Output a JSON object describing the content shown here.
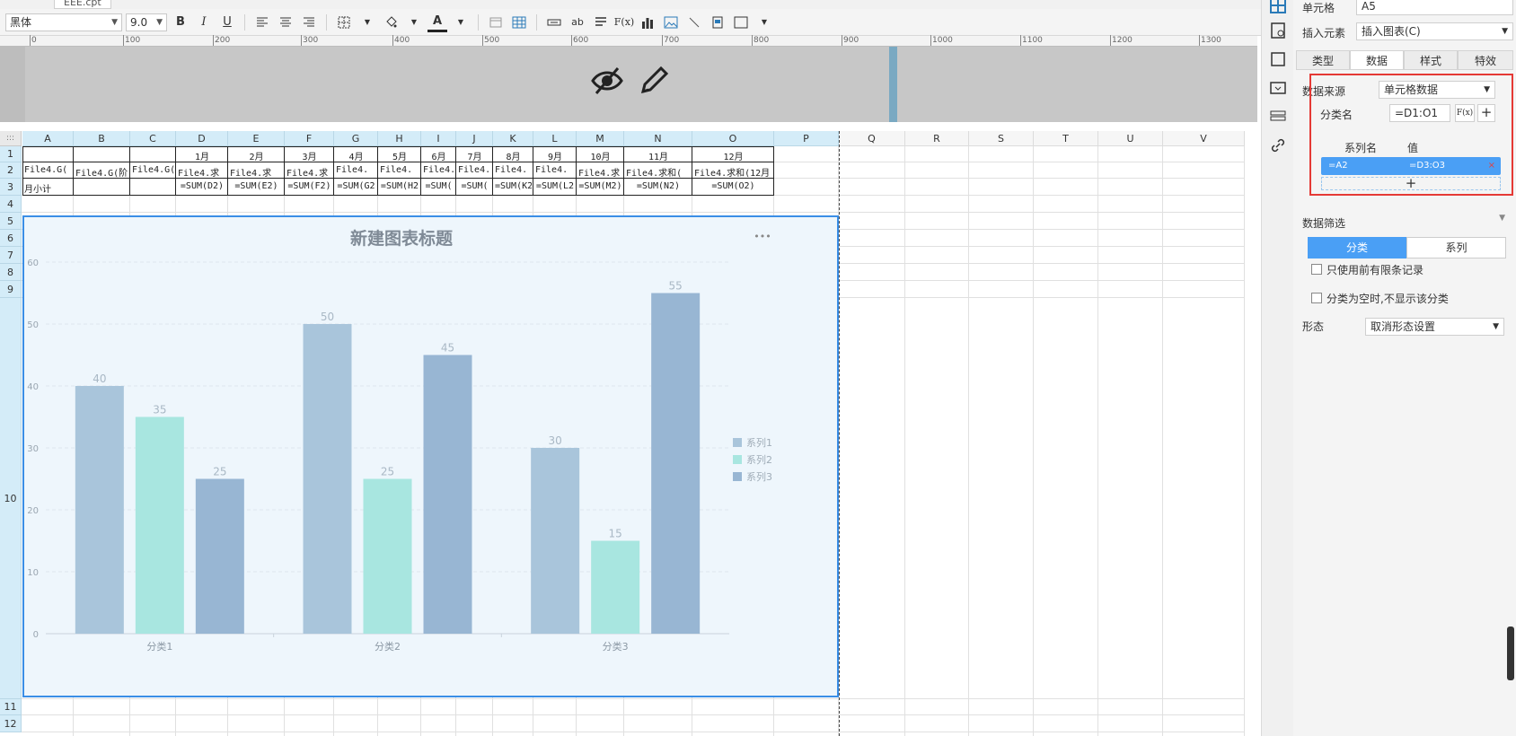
{
  "tab": {
    "label": "EEE.cpt"
  },
  "toolbar": {
    "font_name": "黑体",
    "font_size": "9.0",
    "bold": "B",
    "italic": "I",
    "underline": "U",
    "text_color_glyph": "A",
    "formula_glyph": "F(x)"
  },
  "ruler": {
    "labels": [
      "0",
      "100",
      "200",
      "300",
      "400",
      "500",
      "600",
      "700",
      "800",
      "900",
      "1000",
      "1100",
      "1200",
      "1300"
    ]
  },
  "grid": {
    "columns": [
      "A",
      "B",
      "C",
      "D",
      "E",
      "F",
      "G",
      "H",
      "I",
      "J",
      "K",
      "L",
      "M",
      "N",
      "O",
      "P",
      "Q",
      "R",
      "S",
      "T",
      "U",
      "V"
    ],
    "rows": [
      "1",
      "2",
      "3",
      "4",
      "5",
      "6",
      "7",
      "8",
      "9",
      "10",
      "11",
      "12"
    ],
    "row1": [
      "",
      "",
      "",
      "1月",
      "2月",
      "3月",
      "4月",
      "5月",
      "6月",
      "7月",
      "8月",
      "9月",
      "10月",
      "11月",
      "12月"
    ],
    "row2": [
      "File4.G(",
      "File4.G(阶",
      "File4.G(",
      "File4.求",
      "File4.求",
      "File4.求",
      "File4.",
      "File4.",
      "File4.",
      "File4.",
      "File4.",
      "File4.",
      "File4.求",
      "File4.求和(",
      "File4.求和(12月"
    ],
    "row3": [
      "月小计",
      "",
      "",
      "=SUM(D2)",
      "=SUM(E2)",
      "=SUM(F2)",
      "=SUM(G2",
      "=SUM(H2",
      "=SUM(",
      "=SUM(",
      "=SUM(K2",
      "=SUM(L2",
      "=SUM(M2)",
      "=SUM(N2)",
      "=SUM(O2)"
    ]
  },
  "chart_data": {
    "type": "bar",
    "title": "新建图表标题",
    "categories": [
      "分类1",
      "分类2",
      "分类3"
    ],
    "series": [
      {
        "name": "系列1",
        "values": [
          40,
          50,
          30
        ]
      },
      {
        "name": "系列2",
        "values": [
          35,
          25,
          15
        ]
      },
      {
        "name": "系列3",
        "values": [
          25,
          45,
          55
        ]
      }
    ],
    "ylim": [
      0,
      60
    ],
    "yticks": [
      0,
      10,
      20,
      30,
      40,
      50,
      60
    ],
    "legend_position": "right",
    "more_glyph": "•••",
    "colors": {
      "系列1": "#a9c5db",
      "系列2": "#a8e6e0",
      "系列3": "#98b6d3",
      "label": "#a9b8c5",
      "title": "#7f8a96"
    }
  },
  "sidebar": {
    "cell_label": "单元格",
    "cell_value": "A5",
    "insert_label": "插入元素",
    "insert_value": "插入图表(C)",
    "tabs": [
      "类型",
      "数据",
      "样式",
      "特效"
    ],
    "active_tab": "数据",
    "datasource_label": "数据来源",
    "datasource_value": "单元格数据",
    "category_label": "分类名",
    "category_value": "=D1:O1",
    "fx_glyph": "F(x)",
    "plus_glyph": "+",
    "series_header": "系列名",
    "value_header": "值",
    "series_row": {
      "name": "=A2",
      "value": "=D3:O3",
      "close": "×"
    },
    "filter_label": "数据筛选",
    "seg_left": "分类",
    "seg_right": "系列",
    "opt1": "只使用前有限条记录",
    "opt2": "分类为空时,不显示该分类",
    "form_label": "形态",
    "form_value": "取消形态设置"
  }
}
